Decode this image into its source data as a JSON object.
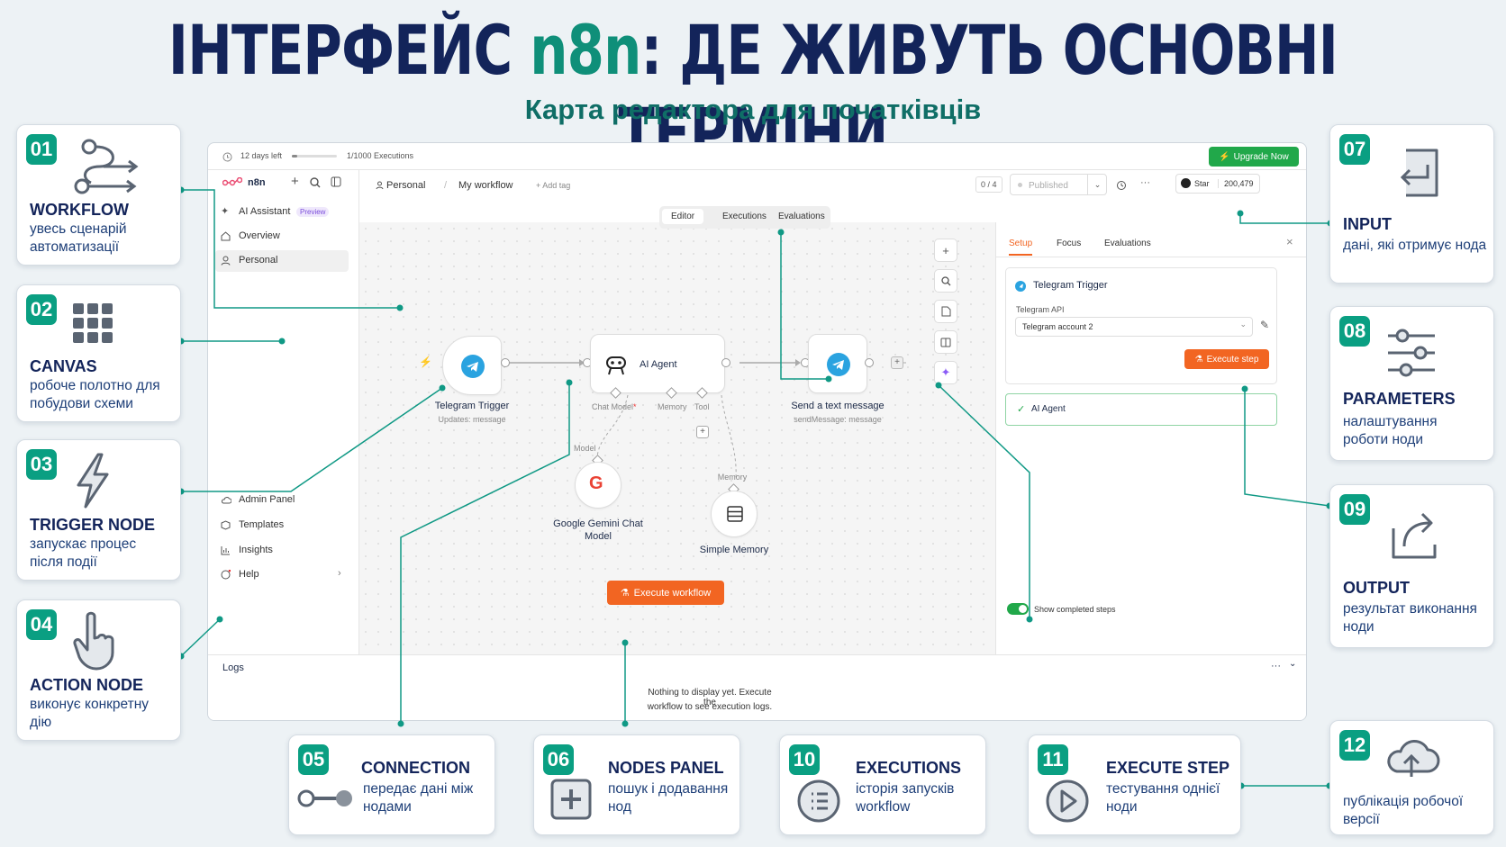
{
  "header": {
    "title_a": "ІНТЕРФЕЙС ",
    "title_accent": "n8n",
    "title_b": ": ДЕ ЖИВУТЬ ОСНОВНІ ТЕРМІНИ",
    "subtitle": "Карта редактора для початківців"
  },
  "cards": [
    {
      "num": "01",
      "title": "WORKFLOW",
      "desc": "увесь сценарій автоматизації",
      "icon": "workflow-icon"
    },
    {
      "num": "02",
      "title": "CANVAS",
      "desc": "робоче полотно для побудови схеми",
      "icon": "grid-icon"
    },
    {
      "num": "03",
      "title": "TRIGGER NODE",
      "desc": "запускає процес після події",
      "icon": "lightning-icon"
    },
    {
      "num": "04",
      "title": "ACTION NODE",
      "desc": "виконує конкретну дію",
      "icon": "hand-pointer-icon"
    },
    {
      "num": "05",
      "title": "CONNECTION",
      "desc": "передає дані між нодами",
      "icon": "connection-icon"
    },
    {
      "num": "06",
      "title": "NODES PANEL",
      "desc": "пошук і додавання нод",
      "icon": "plus-square-icon"
    },
    {
      "num": "10",
      "title": "EXECUTIONS",
      "desc": "історія запусків workflow",
      "icon": "list-icon"
    },
    {
      "num": "11",
      "title": "EXECUTE STEP",
      "desc": "тестування однієї ноди",
      "icon": "play-icon"
    },
    {
      "num": "07",
      "title": "INPUT",
      "desc": "дані, які отримує нода",
      "icon": "input-icon"
    },
    {
      "num": "08",
      "title": "PARAMETERS",
      "desc": "налаштування роботи ноди",
      "icon": "sliders-icon"
    },
    {
      "num": "09",
      "title": "OUTPUT",
      "desc": "результат виконання ноди",
      "icon": "output-icon"
    },
    {
      "num": "12",
      "title": "",
      "desc": "публікація робочої версії",
      "icon": "cloud-upload-icon"
    }
  ],
  "ui": {
    "topbar": {
      "days_left": "12 days left",
      "executions": "1/1000 Executions",
      "upgrade": "Upgrade Now"
    },
    "brand": "n8n",
    "sidebar": {
      "items": [
        "AI Assistant",
        "Overview",
        "Personal"
      ],
      "preview_badge": "Preview",
      "bottom": [
        "Admin Panel",
        "Templates",
        "Insights",
        "Help"
      ]
    },
    "breadcrumb": {
      "project": "Personal",
      "sep": "/",
      "workflow": "My workflow",
      "add_tag": "+ Add tag"
    },
    "header_right": {
      "count": "0 / 4",
      "published": "Published",
      "more": "···",
      "star": "Star",
      "stars": "200,479"
    },
    "mode_tabs": [
      "Editor",
      "Executions",
      "Evaluations"
    ],
    "nodes": {
      "trigger": {
        "name": "Telegram Trigger",
        "sub": "Updates: message"
      },
      "agent": {
        "name": "AI Agent",
        "port_chat": "Chat Model",
        "port_req": "*",
        "port_memory": "Memory",
        "port_tool": "Tool"
      },
      "send": {
        "name": "Send a text message",
        "sub": "sendMessage: message"
      },
      "gemini": {
        "name": "Google Gemini Chat Model",
        "port": "Model"
      },
      "memory": {
        "name": "Simple Memory",
        "port": "Memory"
      }
    },
    "execute_workflow": "Execute workflow",
    "panel": {
      "tabs": [
        "Setup",
        "Focus",
        "Evaluations"
      ],
      "close": "×",
      "node_title": "Telegram Trigger",
      "field_label": "Telegram API",
      "field_value": "Telegram account 2",
      "execute_step": "Execute step",
      "ai_agent": "AI Agent",
      "toggle_label": "Show completed steps"
    },
    "logs": {
      "title": "Logs",
      "empty_line1": "Nothing to display yet. Execute the",
      "empty_line2": "workflow to see execution logs."
    }
  },
  "colors": {
    "accent": "#0a9f82",
    "orange": "#f26522",
    "navy": "#13245a",
    "upgrade": "#21a84a"
  }
}
